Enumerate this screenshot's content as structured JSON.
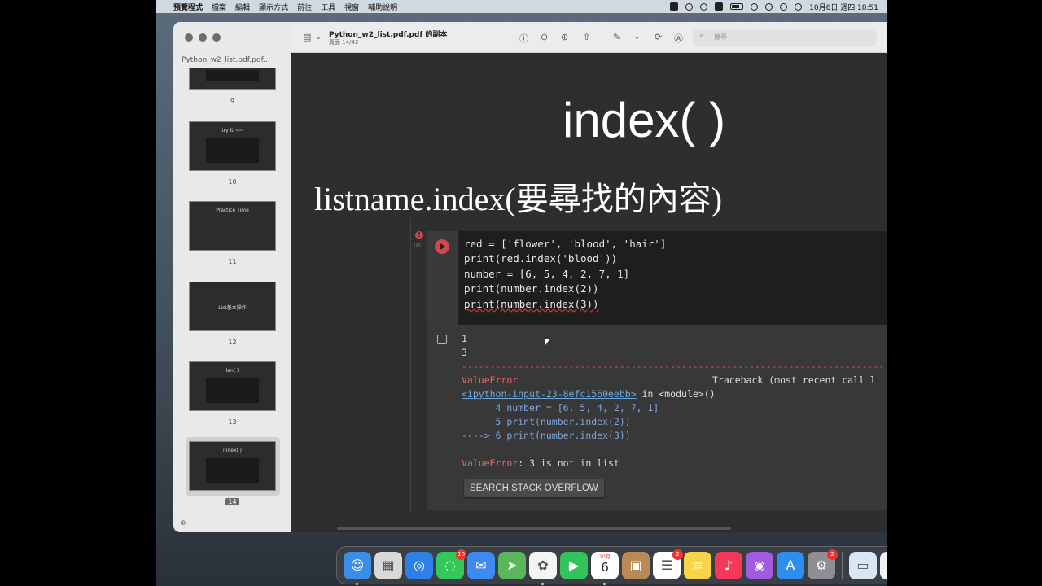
{
  "menubar": {
    "apple": "",
    "app_name": "預覽程式",
    "menus": [
      "檔案",
      "編輯",
      "顯示方式",
      "前往",
      "工具",
      "視窗",
      "輔助說明"
    ],
    "datetime": "10月6日 週四  18:51"
  },
  "sidebar": {
    "doc_name": "Python_w2_list.pdf.pdf...",
    "thumbnails": [
      {
        "page": "9",
        "title": ""
      },
      {
        "page": "10",
        "title": "try it ~~"
      },
      {
        "page": "11",
        "title": "Practice Time"
      },
      {
        "page": "12",
        "title": "List基本操作"
      },
      {
        "page": "13",
        "title": "len( )"
      },
      {
        "page": "14",
        "title": "index( )"
      }
    ],
    "selected_page": "14"
  },
  "toolbar": {
    "title": "Python_w2_list.pdf.pdf 的副本",
    "subtitle": "頁面 14/42",
    "search_placeholder": "搜尋"
  },
  "slide": {
    "title": "index( )",
    "bullet": "listname.index(要尋找的內容)"
  },
  "code_cell": {
    "exec_count": "0s",
    "lines": [
      "red = ['flower', 'blood', 'hair']",
      "print(red.index('blood'))",
      "",
      "number = [6, 5, 4, 2, 7, 1]",
      "print(number.index(2))",
      "print(number.index(3))"
    ]
  },
  "output": {
    "line1": "1",
    "line2": "3",
    "dashes": "---------------------------------------------------------------------------",
    "error_name": "ValueError",
    "traceback_label": "Traceback (most recent call l",
    "source_link": "<ipython-input-23-8efc1560eebb>",
    "in_module": " in <module>()",
    "tb1": "      4 number = [6, 5, 4, 2, 7, 1]",
    "tb2": "      5 print(number.index(2))",
    "tb3_arrow": "----> ",
    "tb3": "6 print(number.index(3))",
    "error_msg": ": 3 is not in list",
    "search_button": "SEARCH STACK OVERFLOW"
  },
  "dock": {
    "apps": [
      {
        "name": "finder",
        "color": "#3b8ee8"
      },
      {
        "name": "launchpad",
        "color": "#d8d8d8"
      },
      {
        "name": "safari",
        "color": "#2f7fe6"
      },
      {
        "name": "messages",
        "color": "#34c759",
        "badge": "10"
      },
      {
        "name": "mail",
        "color": "#3d8bf0"
      },
      {
        "name": "maps",
        "color": "#5bb55b"
      },
      {
        "name": "photos",
        "color": "#f4f4f4"
      },
      {
        "name": "facetime",
        "color": "#32c45a"
      },
      {
        "name": "calendar",
        "color": "#ffffff",
        "label": "6",
        "month": "10月"
      },
      {
        "name": "contacts",
        "color": "#b98a56"
      },
      {
        "name": "reminders",
        "color": "#ffffff",
        "badge": "2"
      },
      {
        "name": "notes",
        "color": "#f6d548"
      },
      {
        "name": "music",
        "color": "#f5385a"
      },
      {
        "name": "podcasts",
        "color": "#a15be0"
      },
      {
        "name": "app-store",
        "color": "#2d8ef0"
      },
      {
        "name": "system-preferences",
        "color": "#8e8e93",
        "badge": "2"
      },
      {
        "name": "preview",
        "color": "#d9e6f5"
      },
      {
        "name": "textedit",
        "color": "#f2f2f2"
      },
      {
        "name": "quicktime",
        "color": "#2a2a2a"
      },
      {
        "name": "screenshot-folder",
        "color": "#555555"
      },
      {
        "name": "trash",
        "color": "#cfcfcf"
      }
    ]
  }
}
